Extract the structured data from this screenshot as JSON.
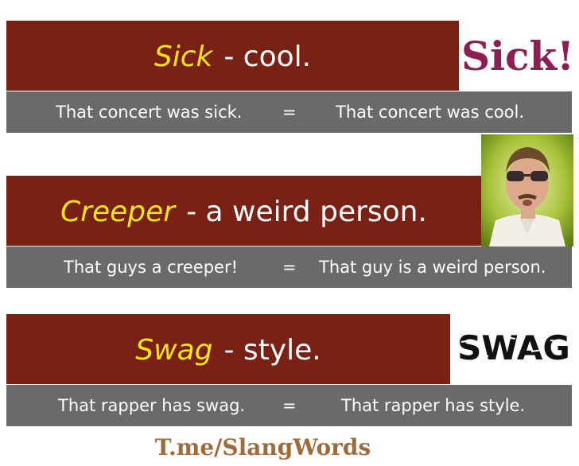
{
  "entries": [
    {
      "term": "Sick",
      "definition": "- cool.",
      "example_slang": "That concert was sick.",
      "equals": "=",
      "example_plain": "That concert was cool.",
      "image_text": "Sick!"
    },
    {
      "term": "Creeper",
      "definition": "- a weird person.",
      "example_slang": "That guys a creeper!",
      "equals": "=",
      "example_plain": "That guy is a weird person."
    },
    {
      "term": "Swag",
      "definition": "- style.",
      "example_slang": "That rapper has swag.",
      "equals": "=",
      "example_plain": "That rapper has style.",
      "image_text": "SWAG"
    }
  ],
  "footer": {
    "link_text": "T.me/SlangWords"
  },
  "colors": {
    "header_bg": "#7a2115",
    "term_text": "#f6e514",
    "example_bg": "#6a6a6a",
    "footer_text": "#a06b3a",
    "sick_logo": "#8e1f52"
  }
}
